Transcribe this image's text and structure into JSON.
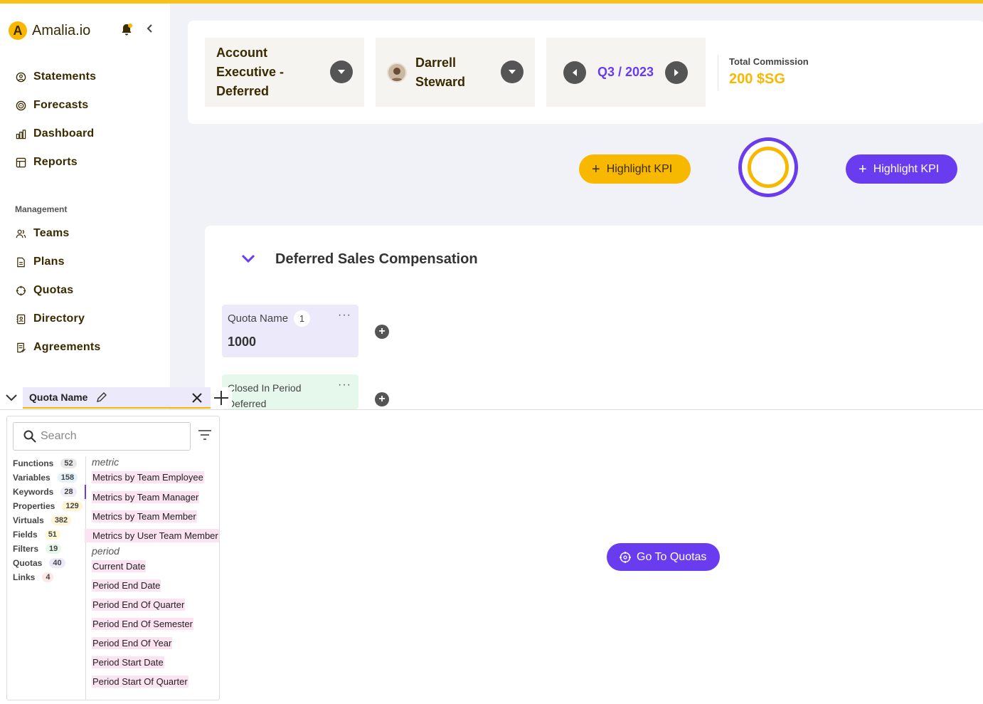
{
  "app": {
    "logo_letter": "A",
    "name": "Amalia.io"
  },
  "sidebar": {
    "items": [
      {
        "label": "Statements",
        "icon": "statement-icon"
      },
      {
        "label": "Forecasts",
        "icon": "forecast-icon"
      },
      {
        "label": "Dashboard",
        "icon": "dashboard-icon"
      },
      {
        "label": "Reports",
        "icon": "reports-icon"
      }
    ],
    "management_title": "Management",
    "management_items": [
      {
        "label": "Teams",
        "icon": "teams-icon"
      },
      {
        "label": "Plans",
        "icon": "plans-icon"
      },
      {
        "label": "Quotas",
        "icon": "quotas-icon"
      },
      {
        "label": "Directory",
        "icon": "directory-icon"
      },
      {
        "label": "Agreements",
        "icon": "agreements-icon"
      }
    ]
  },
  "header": {
    "plan": "Account Executive - Deferred",
    "user": "Darrell Steward",
    "period": "Q3 / 2023",
    "total_commission_label": "Total Commission",
    "total_commission_value": "200 $SG"
  },
  "actions": {
    "highlight_kpi_yellow": "Highlight KPI",
    "highlight_kpi_purple": "Highlight KPI"
  },
  "section": {
    "title": "Deferred Sales Compensation",
    "kpis": [
      {
        "title": "Quota Name",
        "count": "1",
        "value": "1000",
        "more": "···"
      },
      {
        "title": "Closed In Period Deferred",
        "more": "···"
      }
    ]
  },
  "editor": {
    "tab_label": "Quota Name",
    "search_placeholder": "Search",
    "categories": [
      {
        "label": "Functions",
        "count": "52",
        "color": "#e8e8e8"
      },
      {
        "label": "Variables",
        "count": "158",
        "color": "#e3f2fb"
      },
      {
        "label": "Keywords",
        "count": "28",
        "color": "#f0ecf8"
      },
      {
        "label": "Properties",
        "count": "129",
        "color": "#fff5d6"
      },
      {
        "label": "Virtuals",
        "count": "382",
        "color": "#fff5d6"
      },
      {
        "label": "Fields",
        "count": "51",
        "color": "#fff9d6"
      },
      {
        "label": "Filters",
        "count": "19",
        "color": "#e6f7ec"
      },
      {
        "label": "Quotas",
        "count": "40",
        "color": "#ece9fb"
      },
      {
        "label": "Links",
        "count": "4",
        "color": "#fde8e8"
      }
    ],
    "group_metric": "metric",
    "metric_items": [
      "Metrics by Team Employee",
      "Metrics by Team Manager",
      "Metrics by Team Member",
      "Metrics by User Team Member"
    ],
    "group_period": "period",
    "period_items": [
      "Current Date",
      "Period End Date",
      "Period End Of Quarter",
      "Period End Of Semester",
      "Period End Of Year",
      "Period Start Date",
      "Period Start Of Quarter"
    ],
    "goto_label": "Go To Quotas"
  },
  "colors": {
    "accent_yellow": "#f9b800",
    "accent_purple": "#6a3cf0"
  }
}
